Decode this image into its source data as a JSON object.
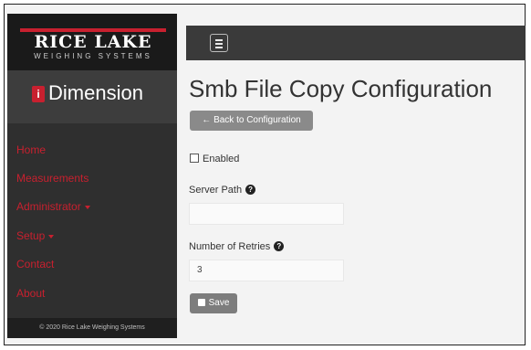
{
  "brand": {
    "company": "RICE LAKE",
    "tagline": "WEIGHING SYSTEMS",
    "product_mark": "i",
    "product": "Dimension"
  },
  "nav": {
    "items": [
      {
        "label": "Home"
      },
      {
        "label": "Measurements"
      },
      {
        "label": "Administrator"
      },
      {
        "label": "Setup"
      },
      {
        "label": "Contact"
      },
      {
        "label": "About"
      }
    ]
  },
  "footer": {
    "text": "© 2020 Rice Lake Weighing Systems"
  },
  "page": {
    "title": "Smb File Copy Configuration",
    "back_label": "← Back to Configuration"
  },
  "form": {
    "enabled_label": "Enabled",
    "server_path_label": "Server Path",
    "server_path_value": "",
    "retries_label": "Number of Retries",
    "retries_value": "3",
    "help_glyph": "?",
    "save_label": "Save"
  },
  "colors": {
    "accent": "#c8202f",
    "sidebar": "#2f2f2f",
    "button": "#8a8a8a"
  }
}
